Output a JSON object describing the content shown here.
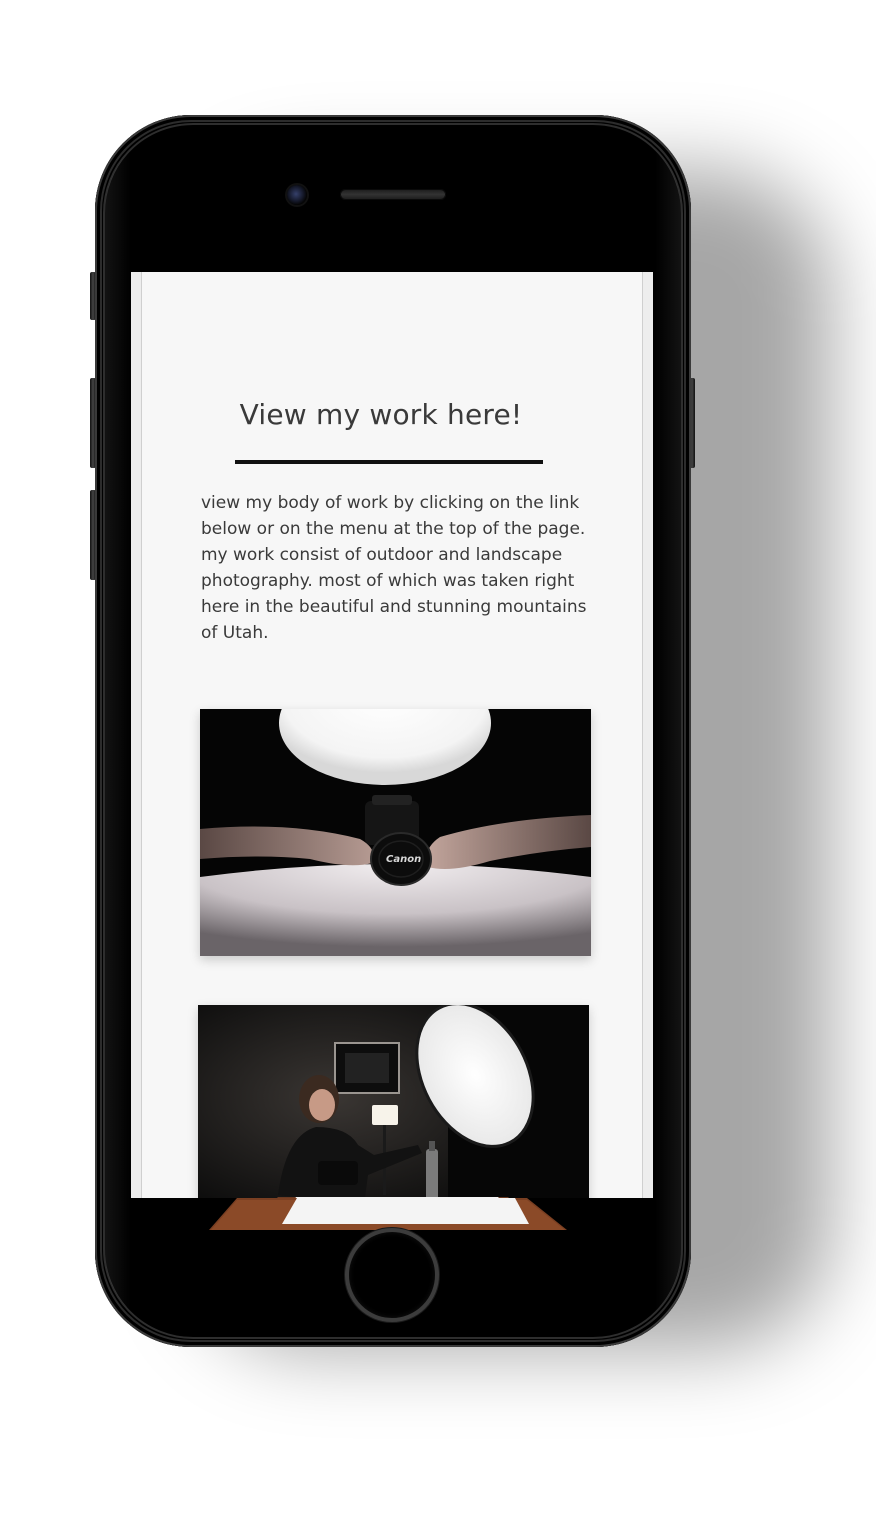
{
  "page": {
    "title": "View my work here!",
    "description": "view my body of work by clicking on the link\nbelow or on the menu  at the top of the page.\nmy work consist of outdoor and landscape\nphotography. most of which was taken right\n here in the beautiful and stunning mountains\nof Utah."
  },
  "photos": [
    {
      "icon": "camera-lens-cap-photo",
      "lens_cap_text": "Canon"
    },
    {
      "icon": "studio-lighting-setup-photo"
    }
  ],
  "colors": {
    "phone_body": "#000000",
    "screen_background": "#f7f7f7",
    "heading_text": "#3a3a3a",
    "rule": "#111111"
  }
}
